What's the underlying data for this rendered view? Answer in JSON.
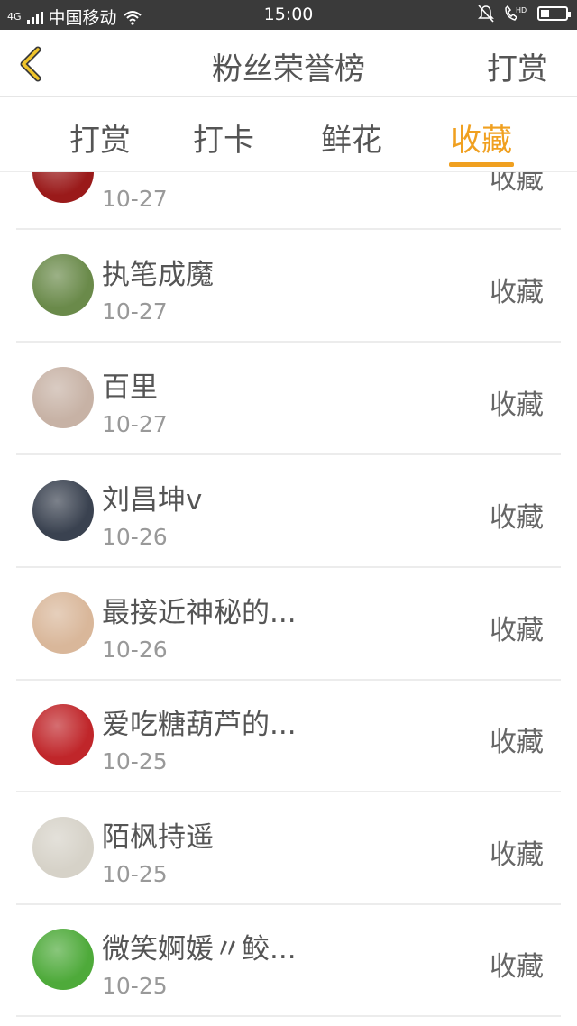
{
  "status_bar": {
    "network": "4G",
    "carrier": "中国移动",
    "time": "15:00",
    "hd": "HD",
    "battery_level": 0.35
  },
  "header": {
    "title": "粉丝荣誉榜",
    "action": "打赏"
  },
  "tabs": [
    {
      "label": "打赏",
      "active": false
    },
    {
      "label": "打卡",
      "active": false
    },
    {
      "label": "鲜花",
      "active": false
    },
    {
      "label": "收藏",
      "active": true
    }
  ],
  "rows": [
    {
      "name": "",
      "date": "10-27",
      "action": "收藏",
      "avatar": "#9a1a1a"
    },
    {
      "name": "执笔成魔",
      "date": "10-27",
      "action": "收藏",
      "avatar": "#6a8a4a"
    },
    {
      "name": "百里",
      "date": "10-27",
      "action": "收藏",
      "avatar": "#c7b2a5"
    },
    {
      "name": "刘昌坤v",
      "date": "10-26",
      "action": "收藏",
      "avatar": "#3a4250"
    },
    {
      "name": "最接近神秘的...",
      "date": "10-26",
      "action": "收藏",
      "avatar": "#d9b79a"
    },
    {
      "name": "爱吃糖葫芦的...",
      "date": "10-25",
      "action": "收藏",
      "avatar": "#c0262a"
    },
    {
      "name": "陌枫持遥",
      "date": "10-25",
      "action": "收藏",
      "avatar": "#d6d2c8"
    },
    {
      "name": "微笑婀媛〃鲛...",
      "date": "10-25",
      "action": "收藏",
      "avatar": "#4eaa3a"
    }
  ]
}
